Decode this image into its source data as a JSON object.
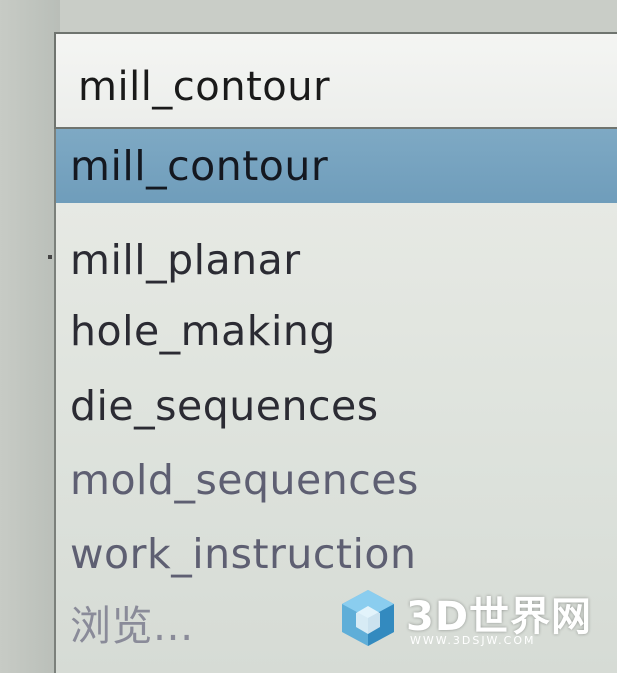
{
  "combo": {
    "selected_value": "mill_contour"
  },
  "list": {
    "items": [
      {
        "label": "mill_contour",
        "state": "selected"
      },
      {
        "label": "mill_planar",
        "state": "normal"
      },
      {
        "label": "hole_making",
        "state": "normal"
      },
      {
        "label": "die_sequences",
        "state": "normal"
      },
      {
        "label": "mold_sequences",
        "state": "faded"
      },
      {
        "label": "work_instruction",
        "state": "faded"
      },
      {
        "label": "浏览...",
        "state": "faint"
      }
    ]
  },
  "watermark": {
    "brand": "3D世界网",
    "url": "WWW.3DSJW.COM"
  },
  "colors": {
    "selection": "#7ea9c4",
    "list_bg": "#e9ebe6",
    "watermark_logo": "#4aa6d8"
  }
}
